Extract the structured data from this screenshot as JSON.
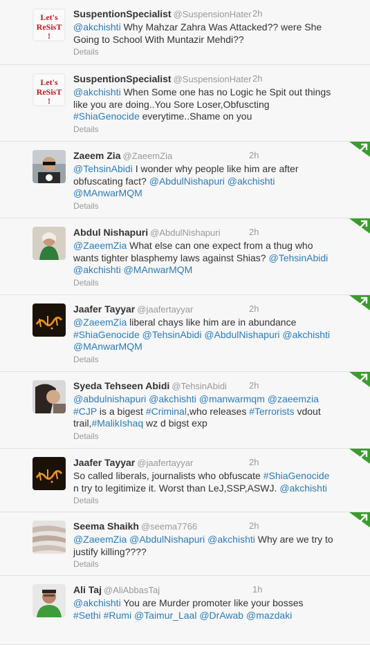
{
  "tweets": [
    {
      "fullname": "SuspentionSpecialist",
      "username": "@SuspensionHater",
      "time": "2h",
      "avatar": "lets-resist-avatar",
      "badge": false,
      "details": "Details",
      "lines": [
        [
          {
            "t": "@akchishti",
            "link": true
          },
          {
            "t": " Why Mahzar Zahra Was Attacked?? were She"
          }
        ],
        [
          {
            "t": "Going to School With Muntazir Mehdi??"
          }
        ]
      ]
    },
    {
      "fullname": "SuspentionSpecialist",
      "username": "@SuspensionHater",
      "time": "2h",
      "avatar": "lets-resist-avatar",
      "badge": false,
      "details": "Details",
      "lines": [
        [
          {
            "t": "@akchishti",
            "link": true
          },
          {
            "t": " When Some one has no Logic he Spit out things"
          }
        ],
        [
          {
            "t": "like you are doing..You Sore Loser,Obfuscting"
          }
        ],
        [
          {
            "t": "#ShiaGenocide",
            "link": true
          },
          {
            "t": " everytime..Shame on you"
          }
        ]
      ]
    },
    {
      "fullname": "Zaeem Zia",
      "username": "@ZaeemZia",
      "time": "2h",
      "avatar": "man-sunglasses-avatar",
      "badge": true,
      "details": "Details",
      "lines": [
        [
          {
            "t": "@TehsinAbidi",
            "link": true
          },
          {
            "t": " I wonder why people like him are after"
          }
        ],
        [
          {
            "t": "obfuscating fact? "
          },
          {
            "t": "@AbdulNishapuri",
            "link": true
          },
          {
            "t": " "
          },
          {
            "t": "@akchishti",
            "link": true
          }
        ],
        [
          {
            "t": "@MAnwarMQM",
            "link": true
          }
        ]
      ]
    },
    {
      "fullname": "Abdul Nishapuri",
      "username": "@AbdulNishapuri",
      "time": "2h",
      "avatar": "woman-green-scarf-avatar",
      "badge": true,
      "details": "Details",
      "lines": [
        [
          {
            "t": "@ZaeemZia",
            "link": true
          },
          {
            "t": " What else can one expect from a thug who"
          }
        ],
        [
          {
            "t": "wants tighter blasphemy laws against Shias? "
          },
          {
            "t": "@TehsinAbidi",
            "link": true
          }
        ],
        [
          {
            "t": "@akchishti",
            "link": true
          },
          {
            "t": " "
          },
          {
            "t": "@MAnwarMQM",
            "link": true
          }
        ]
      ]
    },
    {
      "fullname": "Jaafer Tayyar",
      "username": "@jaafertayyar",
      "time": "2h",
      "avatar": "calligraphy-avatar",
      "badge": true,
      "details": "Details",
      "lines": [
        [
          {
            "t": "@ZaeemZia",
            "link": true
          },
          {
            "t": " liberal chays like him are in abundance"
          }
        ],
        [
          {
            "t": "#ShiaGenocide",
            "link": true
          },
          {
            "t": " "
          },
          {
            "t": "@TehsinAbidi",
            "link": true
          },
          {
            "t": " "
          },
          {
            "t": "@AbdulNishapuri",
            "link": true
          },
          {
            "t": " "
          },
          {
            "t": "@akchishti",
            "link": true
          }
        ],
        [
          {
            "t": "@MAnwarMQM",
            "link": true
          }
        ]
      ]
    },
    {
      "fullname": "Syeda Tehseen Abidi",
      "username": "@TehsinAbidi",
      "time": "2h",
      "avatar": "woman-portrait-avatar",
      "badge": true,
      "details": "Details",
      "lines": [
        [
          {
            "t": "@abdulnishapuri",
            "link": true
          },
          {
            "t": " "
          },
          {
            "t": "@akchishti",
            "link": true
          },
          {
            "t": " "
          },
          {
            "t": "@manwarmqm",
            "link": true
          },
          {
            "t": " "
          },
          {
            "t": "@zaeemzia",
            "link": true
          }
        ],
        [
          {
            "t": "#CJP",
            "link": true
          },
          {
            "t": " is a bigest "
          },
          {
            "t": "#Criminal",
            "link": true
          },
          {
            "t": ",who releases "
          },
          {
            "t": "#Terrorists",
            "link": true
          },
          {
            "t": " vdout"
          }
        ],
        [
          {
            "t": "trail,"
          },
          {
            "t": "#MalikIshaq",
            "link": true
          },
          {
            "t": " wz d bigst exp"
          }
        ]
      ]
    },
    {
      "fullname": "Jaafer Tayyar",
      "username": "@jaafertayyar",
      "time": "2h",
      "avatar": "calligraphy-avatar",
      "badge": true,
      "details": "Details",
      "lines": [
        [
          {
            "t": "So called liberals, journalists who obfuscate "
          },
          {
            "t": "#ShiaGenocide",
            "link": true
          }
        ],
        [
          {
            "t": "n try to legitimize it. Worst than LeJ,SSP,ASWJ. "
          },
          {
            "t": "@akchishti",
            "link": true
          }
        ]
      ]
    },
    {
      "fullname": "Seema Shaikh",
      "username": "@seema7766",
      "time": "2h",
      "avatar": "fabric-avatar",
      "badge": true,
      "details": "Details",
      "lines": [
        [
          {
            "t": "@ZaeemZia",
            "link": true
          },
          {
            "t": " "
          },
          {
            "t": "@AbdulNishapuri",
            "link": true
          },
          {
            "t": " "
          },
          {
            "t": "@akchishti",
            "link": true
          },
          {
            "t": " Why are we try to"
          }
        ],
        [
          {
            "t": "justify killing????"
          }
        ]
      ]
    },
    {
      "fullname": "Ali Taj",
      "username": "@AliAbbasTaj",
      "time": "1h",
      "avatar": "man-green-shirt-avatar",
      "badge": false,
      "details": "",
      "lines": [
        [
          {
            "t": "@akchishti",
            "link": true
          },
          {
            "t": " You are Murder promoter like your bosses"
          }
        ],
        [
          {
            "t": "#Sethi",
            "link": true
          },
          {
            "t": " "
          },
          {
            "t": "#Rumi",
            "link": true
          },
          {
            "t": " "
          },
          {
            "t": "@Taimur_Laal",
            "link": true
          },
          {
            "t": " "
          },
          {
            "t": "@DrAwab",
            "link": true
          },
          {
            "t": " "
          },
          {
            "t": "@mazdaki",
            "link": true
          }
        ]
      ]
    }
  ],
  "colors": {
    "link": "#2b7bb9",
    "badge": "#3b9c2e",
    "muted": "#999999"
  }
}
